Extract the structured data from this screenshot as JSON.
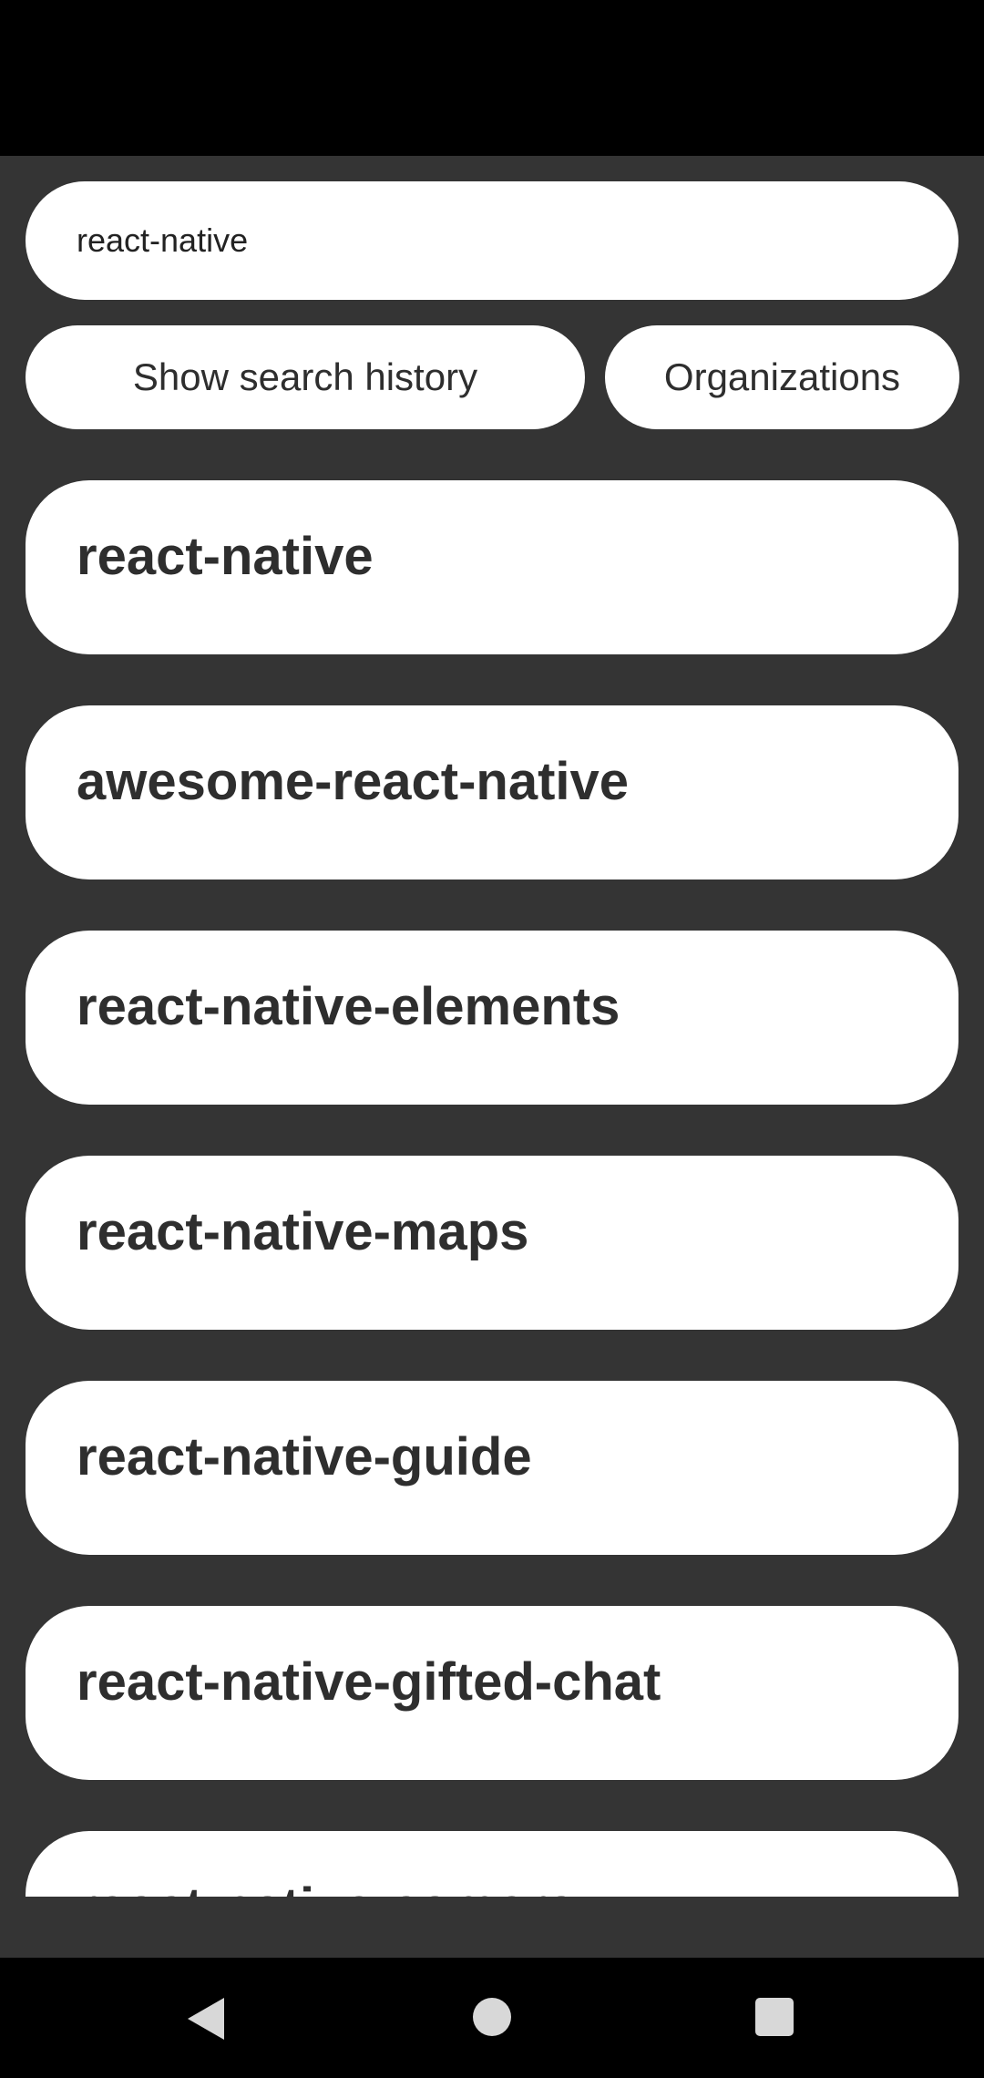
{
  "search": {
    "value": "react-native"
  },
  "buttons": {
    "history_label": "Show search history",
    "organizations_label": "Organizations"
  },
  "results": [
    {
      "name": "react-native"
    },
    {
      "name": "awesome-react-native"
    },
    {
      "name": "react-native-elements"
    },
    {
      "name": "react-native-maps"
    },
    {
      "name": "react-native-guide"
    },
    {
      "name": "react-native-gifted-chat"
    },
    {
      "name": "react-native-camera"
    }
  ],
  "navigation": {
    "back_icon": "triangle-back-icon",
    "home_icon": "circle-home-icon",
    "recents_icon": "square-recents-icon"
  },
  "colors": {
    "background": "#343434",
    "card": "#ffffff",
    "text": "#2e2e2e",
    "system_bars": "#000000"
  }
}
